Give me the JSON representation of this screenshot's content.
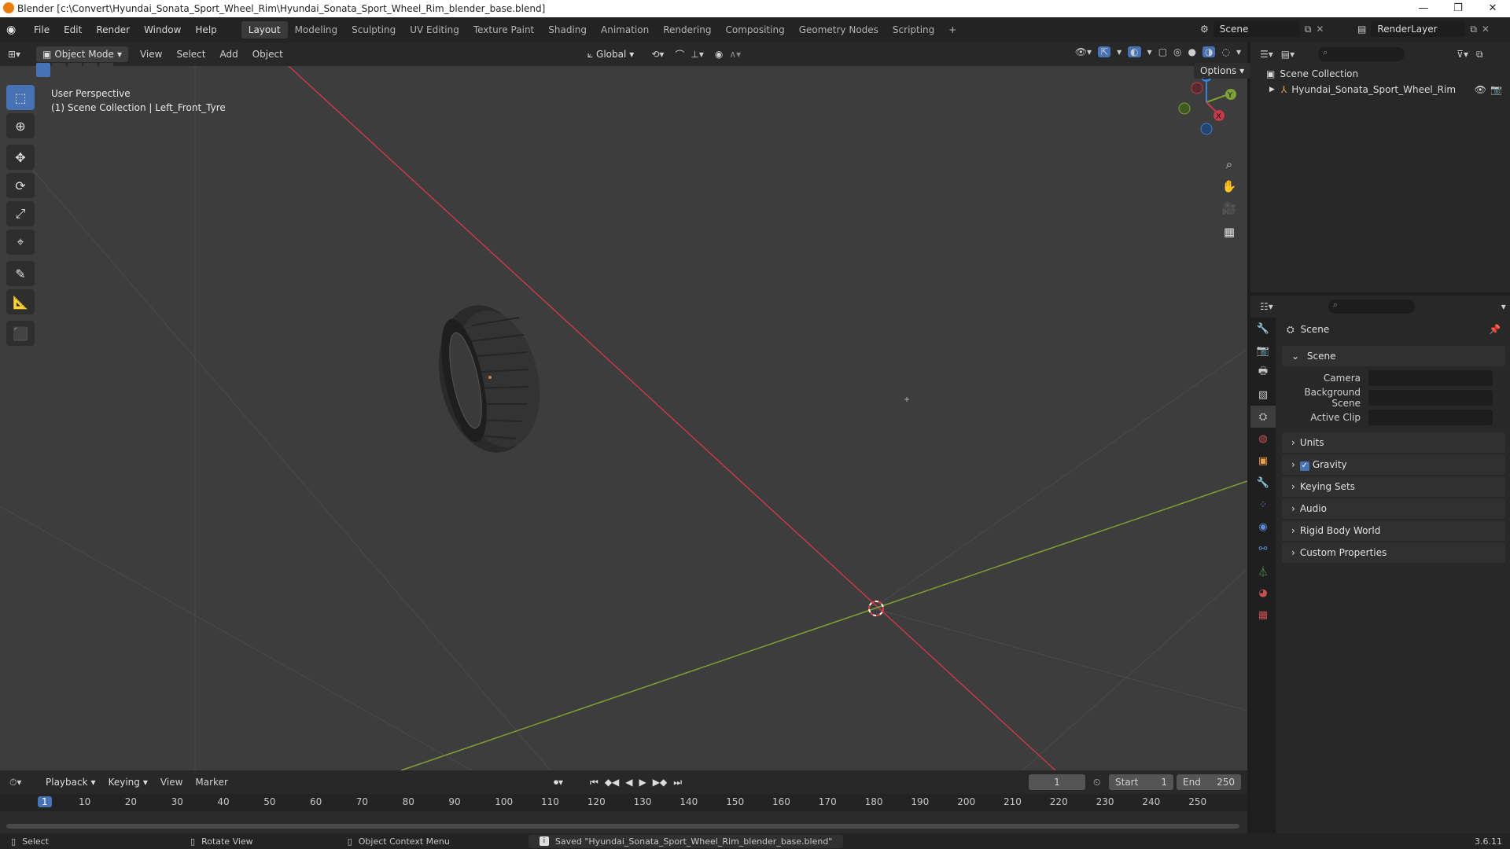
{
  "window": {
    "title": "Blender [c:\\Convert\\Hyundai_Sonata_Sport_Wheel_Rim\\Hyundai_Sonata_Sport_Wheel_Rim_blender_base.blend]",
    "minimize": "—",
    "maximize": "❐",
    "close": "✕"
  },
  "menu": [
    "File",
    "Edit",
    "Render",
    "Window",
    "Help"
  ],
  "workspaces": [
    "Layout",
    "Modeling",
    "Sculpting",
    "UV Editing",
    "Texture Paint",
    "Shading",
    "Animation",
    "Rendering",
    "Compositing",
    "Geometry Nodes",
    "Scripting"
  ],
  "workspace_add": "+",
  "scene_name": "Scene",
  "renderlayer_name": "RenderLayer",
  "viewport": {
    "mode": "Object Mode",
    "menus": [
      "View",
      "Select",
      "Add",
      "Object"
    ],
    "orientation": "Global",
    "info_line1": "User Perspective",
    "info_line2": "(1) Scene Collection | Left_Front_Tyre",
    "options": "Options",
    "gizmo_labels": {
      "x": "X",
      "y": "Y",
      "z": "Z"
    }
  },
  "outliner": {
    "collection": "Scene Collection",
    "item": "Hyundai_Sonata_Sport_Wheel_Rim"
  },
  "properties": {
    "header": "Scene",
    "panel_scene": "Scene",
    "fields": [
      {
        "label": "Camera"
      },
      {
        "label": "Background Scene"
      },
      {
        "label": "Active Clip"
      }
    ],
    "panels": [
      "Units",
      "Gravity",
      "Keying Sets",
      "Audio",
      "Rigid Body World",
      "Custom Properties"
    ],
    "gravity_checked": true
  },
  "timeline": {
    "menus": [
      "Playback",
      "Keying",
      "View",
      "Marker"
    ],
    "current_frame": "1",
    "start_label": "Start",
    "start": "1",
    "end_label": "End",
    "end": "250",
    "ticks": [
      "1",
      "10",
      "20",
      "30",
      "40",
      "50",
      "60",
      "70",
      "80",
      "90",
      "100",
      "110",
      "120",
      "130",
      "140",
      "150",
      "160",
      "170",
      "180",
      "190",
      "200",
      "210",
      "220",
      "230",
      "240",
      "250"
    ]
  },
  "status": {
    "select": "Select",
    "rotate": "Rotate View",
    "context": "Object Context Menu",
    "message": "Saved \"Hyundai_Sonata_Sport_Wheel_Rim_blender_base.blend\"",
    "version": "3.6.11"
  },
  "colors": {
    "accent": "#4772b3",
    "x_axis": "#c5394b",
    "y_axis": "#7ea131",
    "z_axis": "#3b7ed8"
  }
}
